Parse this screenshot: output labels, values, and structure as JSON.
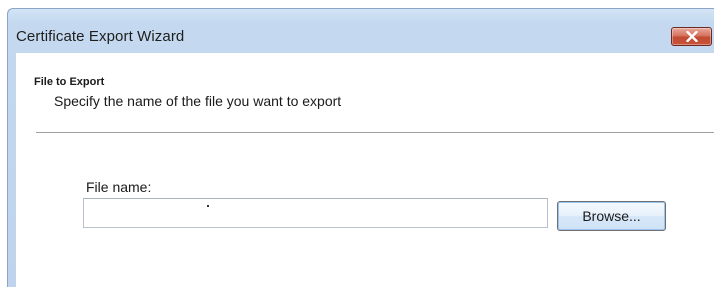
{
  "window": {
    "title": "Certificate Export Wizard"
  },
  "page": {
    "section_title": "File to Export",
    "section_subtitle": "Specify the name of the file you want to export"
  },
  "file_name": {
    "label": "File name:",
    "value": ""
  },
  "browse_button": {
    "label": "Browse..."
  },
  "icons": {
    "close": "close-icon"
  },
  "colors": {
    "frame": "#c4d9ef",
    "close_button": "#c9533b",
    "button_border": "#707070"
  }
}
